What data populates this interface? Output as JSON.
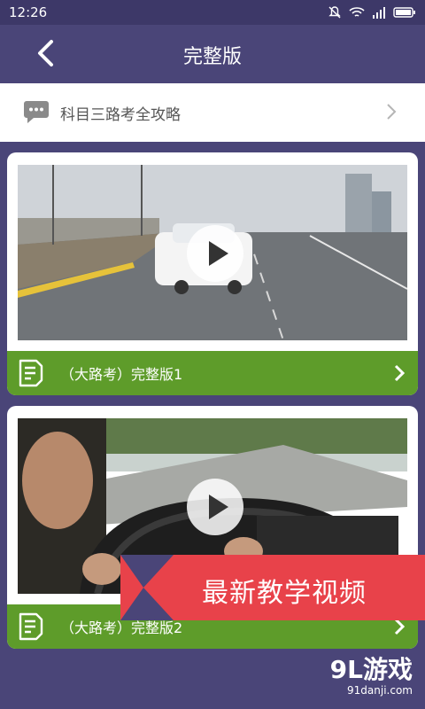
{
  "status": {
    "time": "12:26"
  },
  "header": {
    "title": "完整版"
  },
  "banner": {
    "label": "科目三路考全攻略"
  },
  "videos": [
    {
      "label": "（大路考）完整版1"
    },
    {
      "label": "（大路考）完整版2"
    }
  ],
  "promo": {
    "text": "最新教学视频"
  },
  "watermark": {
    "brand": "9L游戏",
    "site": "91danji.com"
  },
  "colors": {
    "header": "#4a4578",
    "footer": "#5e9c2a",
    "promo": "#e8424a"
  }
}
